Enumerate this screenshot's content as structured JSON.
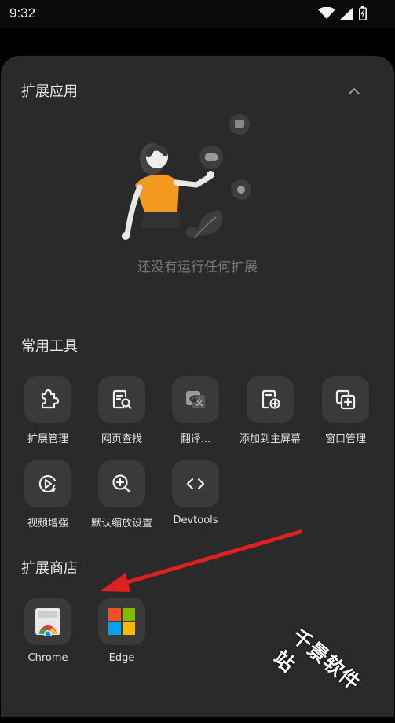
{
  "status": {
    "time": "9:32"
  },
  "extensions": {
    "title": "扩展应用",
    "empty_text": "还没有运行任何扩展"
  },
  "tools": {
    "title": "常用工具",
    "items": [
      {
        "label": "扩展管理",
        "icon": "puzzle-icon"
      },
      {
        "label": "网页查找",
        "icon": "page-search-icon"
      },
      {
        "label": "翻译...",
        "icon": "translate-icon"
      },
      {
        "label": "添加到主屏幕",
        "icon": "add-to-home-icon"
      },
      {
        "label": "窗口管理",
        "icon": "window-add-icon"
      },
      {
        "label": "视频增强",
        "icon": "video-enhance-icon"
      },
      {
        "label": "默认缩放设置",
        "icon": "zoom-in-icon"
      },
      {
        "label": "Devtools",
        "icon": "code-icon"
      }
    ]
  },
  "store": {
    "title": "扩展商店",
    "items": [
      {
        "label": "Chrome",
        "icon": "chrome-icon"
      },
      {
        "label": "Edge",
        "icon": "microsoft-icon"
      }
    ]
  },
  "watermark": "千景软件站",
  "colors": {
    "sheet": "#2a2a2b",
    "button": "#3a3a3b",
    "arrow": "#e02020",
    "illustration_shirt": "#f39a1e"
  }
}
